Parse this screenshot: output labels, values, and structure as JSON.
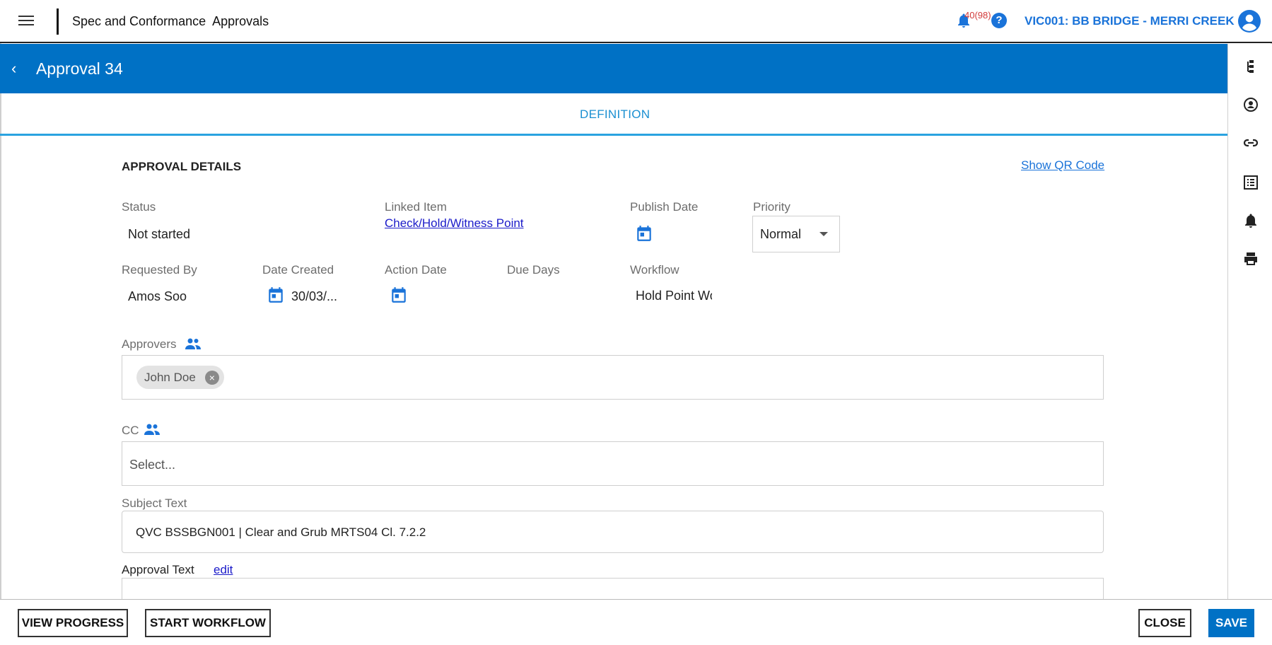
{
  "header": {
    "app_name": "Spec and Conformance",
    "module_name": "Approvals",
    "notifications": "40(98)",
    "help": "?",
    "project": "VIC001: BB BRIDGE - MERRI CREEK"
  },
  "titlebar": {
    "back": "‹",
    "title": "Approval 34"
  },
  "tabs": {
    "definition": "DEFINITION"
  },
  "details": {
    "section_title": "APPROVAL DETAILS",
    "qr_link": "Show QR Code",
    "status_label": "Status",
    "status_value": "Not started",
    "linked_item_label": "Linked Item",
    "linked_item_value": "Check/Hold/Witness Point",
    "publish_date_label": "Publish Date",
    "priority_label": "Priority",
    "priority_value": "Normal",
    "requested_by_label": "Requested By",
    "requested_by_value": "Amos Soo",
    "date_created_label": "Date Created",
    "date_created_value": "30/03/...",
    "action_date_label": "Action Date",
    "due_days_label": "Due Days",
    "workflow_label": "Workflow",
    "workflow_value": "Hold Point Workflow",
    "approvers_label": "Approvers",
    "approvers": [
      "John Doe"
    ],
    "cc_label": "CC",
    "cc_placeholder": "Select...",
    "subject_label": "Subject Text",
    "subject_value": "QVC BSSBGN001 | Clear and Grub MRTS04 Cl. 7.2.2",
    "approval_text_label": "Approval Text",
    "approval_text_edit": "edit"
  },
  "footer": {
    "view_progress": "VIEW PROGRESS",
    "start_workflow": "START WORKFLOW",
    "close": "CLOSE",
    "save": "SAVE"
  },
  "icons": {
    "menu": "menu-icon",
    "bell": "bell-icon",
    "help": "help-icon",
    "account": "account-icon",
    "calendar": "calendar-icon",
    "people": "people-icon",
    "remove": "remove-chip-icon",
    "rail": [
      "hierarchy-icon",
      "user-badge-icon",
      "link-icon",
      "list-icon",
      "bell-icon",
      "print-icon"
    ]
  },
  "colors": {
    "brand_blue": "#0071c5",
    "link_blue": "#1a73d9",
    "tab_accent": "#2aa3e0",
    "alert_red": "#d23a3a"
  }
}
